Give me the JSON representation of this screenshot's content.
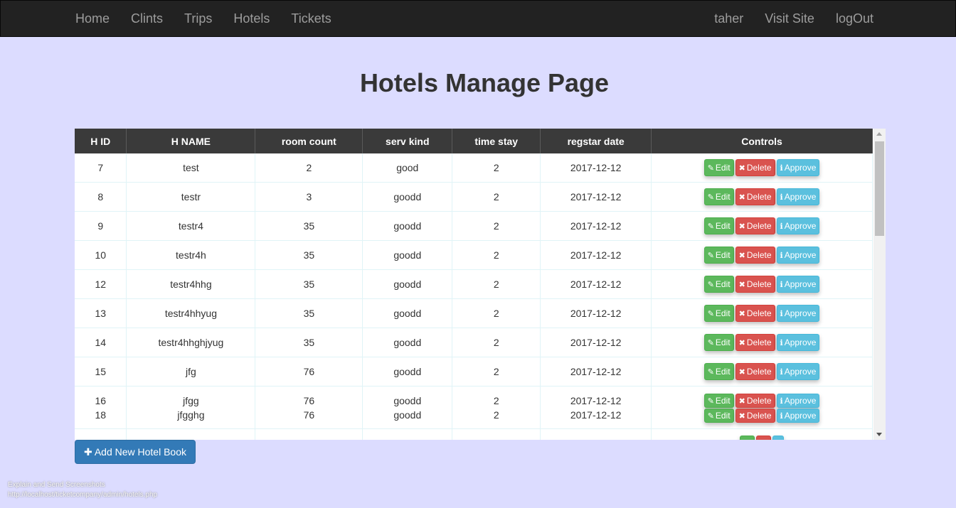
{
  "nav": {
    "left": [
      "Home",
      "Clints",
      "Trips",
      "Hotels",
      "Tickets"
    ],
    "right": [
      "taher",
      "Visit Site",
      "logOut"
    ]
  },
  "page_title": "Hotels Manage Page",
  "table": {
    "headers": [
      "H ID",
      "H NAME",
      "room count",
      "serv kind",
      "time stay",
      "regstar date",
      "Controls"
    ],
    "rows": [
      [
        "7",
        "test",
        "2",
        "good",
        "2",
        "2017-12-12"
      ],
      [
        "8",
        "testr",
        "3",
        "goodd",
        "2",
        "2017-12-12"
      ],
      [
        "9",
        "testr4",
        "35",
        "goodd",
        "2",
        "2017-12-12"
      ],
      [
        "10",
        "testr4h",
        "35",
        "goodd",
        "2",
        "2017-12-12"
      ],
      [
        "12",
        "testr4hhg",
        "35",
        "goodd",
        "2",
        "2017-12-12"
      ],
      [
        "13",
        "testr4hhyug",
        "35",
        "goodd",
        "2",
        "2017-12-12"
      ],
      [
        "14",
        "testr4hhghjyug",
        "35",
        "goodd",
        "2",
        "2017-12-12"
      ],
      [
        "15",
        "jfg",
        "76",
        "goodd",
        "2",
        "2017-12-12"
      ]
    ],
    "double_row": [
      [
        "16",
        "jfgg",
        "76",
        "goodd",
        "2",
        "2017-12-12"
      ],
      [
        "18",
        "jfgghg",
        "76",
        "goodd",
        "2",
        "2017-12-12"
      ]
    ],
    "buttons": {
      "edit": "Edit",
      "delete": "Delete",
      "approve": "Approve"
    },
    "icons": {
      "edit": "edit-icon",
      "delete": "close-icon",
      "approve": "info-icon"
    }
  },
  "add_button": "Add New Hotel Book",
  "footer": {
    "line1": "Explain and Send Screenshots",
    "line2": "http://localhost/ticketcompany/admin/hotels.php"
  },
  "colors": {
    "page_bg": "#dcdcff",
    "navbar": "#222222",
    "edit": "#5cb85c",
    "delete": "#d9534f",
    "approve": "#5bc0de",
    "primary": "#337ab7"
  }
}
